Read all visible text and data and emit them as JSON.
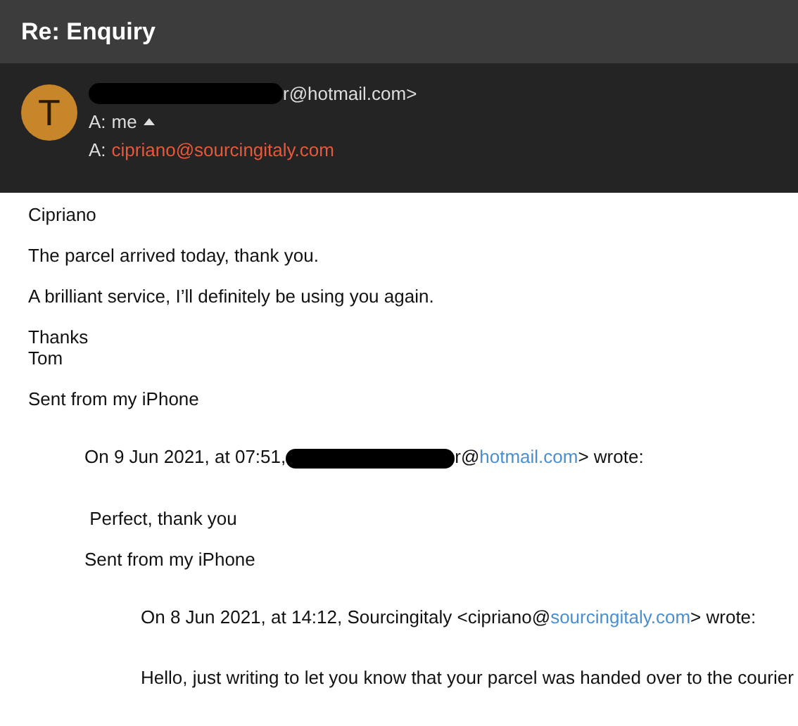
{
  "title": "Re: Enquiry",
  "header": {
    "avatar_letter": "T",
    "from": {
      "redacted": true,
      "text": "r@hotmail.com>"
    },
    "recipients": [
      {
        "prefix": "A:",
        "value": "me",
        "kind": "toggle",
        "expanded": true
      },
      {
        "prefix": "A:",
        "value": "cipriano@sourcingitaly.com",
        "kind": "link"
      }
    ]
  },
  "body": [
    {
      "kind": "para",
      "lines": [
        "Cipriano"
      ]
    },
    {
      "kind": "para",
      "lines": [
        "The parcel arrived today, thank you."
      ]
    },
    {
      "kind": "para",
      "lines": [
        "A brilliant service, I’ll definitely be using you again."
      ]
    },
    {
      "kind": "para",
      "lines": [
        "Thanks",
        "Tom"
      ]
    },
    {
      "kind": "para",
      "lines": [
        "Sent from my iPhone"
      ]
    },
    {
      "kind": "quote",
      "attribution": {
        "before": "On 9 Jun 2021, at 07:51,",
        "redacted": true,
        "mid": "r@",
        "link": "hotmail.com",
        "after": "> wrote:"
      },
      "children": [
        {
          "kind": "para",
          "lines": [
            " Perfect, thank you"
          ]
        },
        {
          "kind": "para",
          "lines": [
            "Sent from my iPhone"
          ]
        },
        {
          "kind": "quote",
          "attribution": {
            "before": "On 8 Jun 2021, at 14:12, Sourcingitaly <cipriano@",
            "redacted": false,
            "link": "sourcingitaly.com",
            "after": "> wrote:"
          },
          "children": [
            {
              "kind": "para",
              "lines": [
                "Hello, just writing to let you know that your parcel was handed over to the courier"
              ]
            }
          ]
        }
      ]
    }
  ]
}
